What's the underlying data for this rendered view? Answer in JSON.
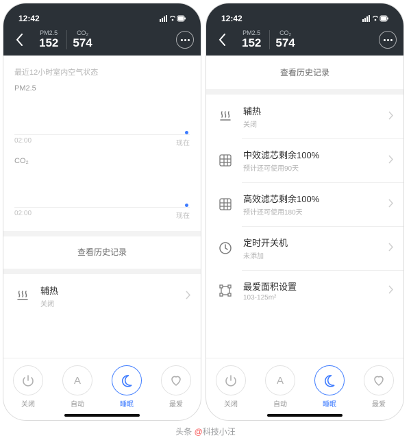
{
  "status": {
    "time": "12:42"
  },
  "header": {
    "pm25_label": "PM2.5",
    "pm25_value": "152",
    "co2_label": "CO₂",
    "co2_value": "574"
  },
  "left": {
    "recent_title": "最近12小时室内空气状态",
    "pm25_label": "PM2.5",
    "co2_label": "CO₂",
    "axis_start": "02:00",
    "axis_end": "现在",
    "history": "查看历史记录",
    "aux_heat_title": "辅热",
    "aux_heat_sub": "关闭"
  },
  "right": {
    "history": "查看历史记录",
    "rows": [
      {
        "icon": "heat",
        "title": "辅热",
        "sub": "关闭"
      },
      {
        "icon": "mesh",
        "title": "中效滤芯剩余100%",
        "sub": "预计还可使用90天"
      },
      {
        "icon": "mesh",
        "title": "高效滤芯剩余100%",
        "sub": "预计还可使用180天"
      },
      {
        "icon": "clock",
        "title": "定时开关机",
        "sub": "未添加"
      },
      {
        "icon": "area",
        "title": "最爱面积设置",
        "sub": "103-125m²"
      }
    ]
  },
  "bottom": {
    "items": [
      {
        "label": "关闭",
        "active": false
      },
      {
        "label": "自动",
        "active": false
      },
      {
        "label": "睡眠",
        "active": true
      },
      {
        "label": "最爱",
        "active": false
      }
    ]
  },
  "watermark": {
    "prefix": "头条 ",
    "at": "@",
    "name": "科技小汪"
  }
}
